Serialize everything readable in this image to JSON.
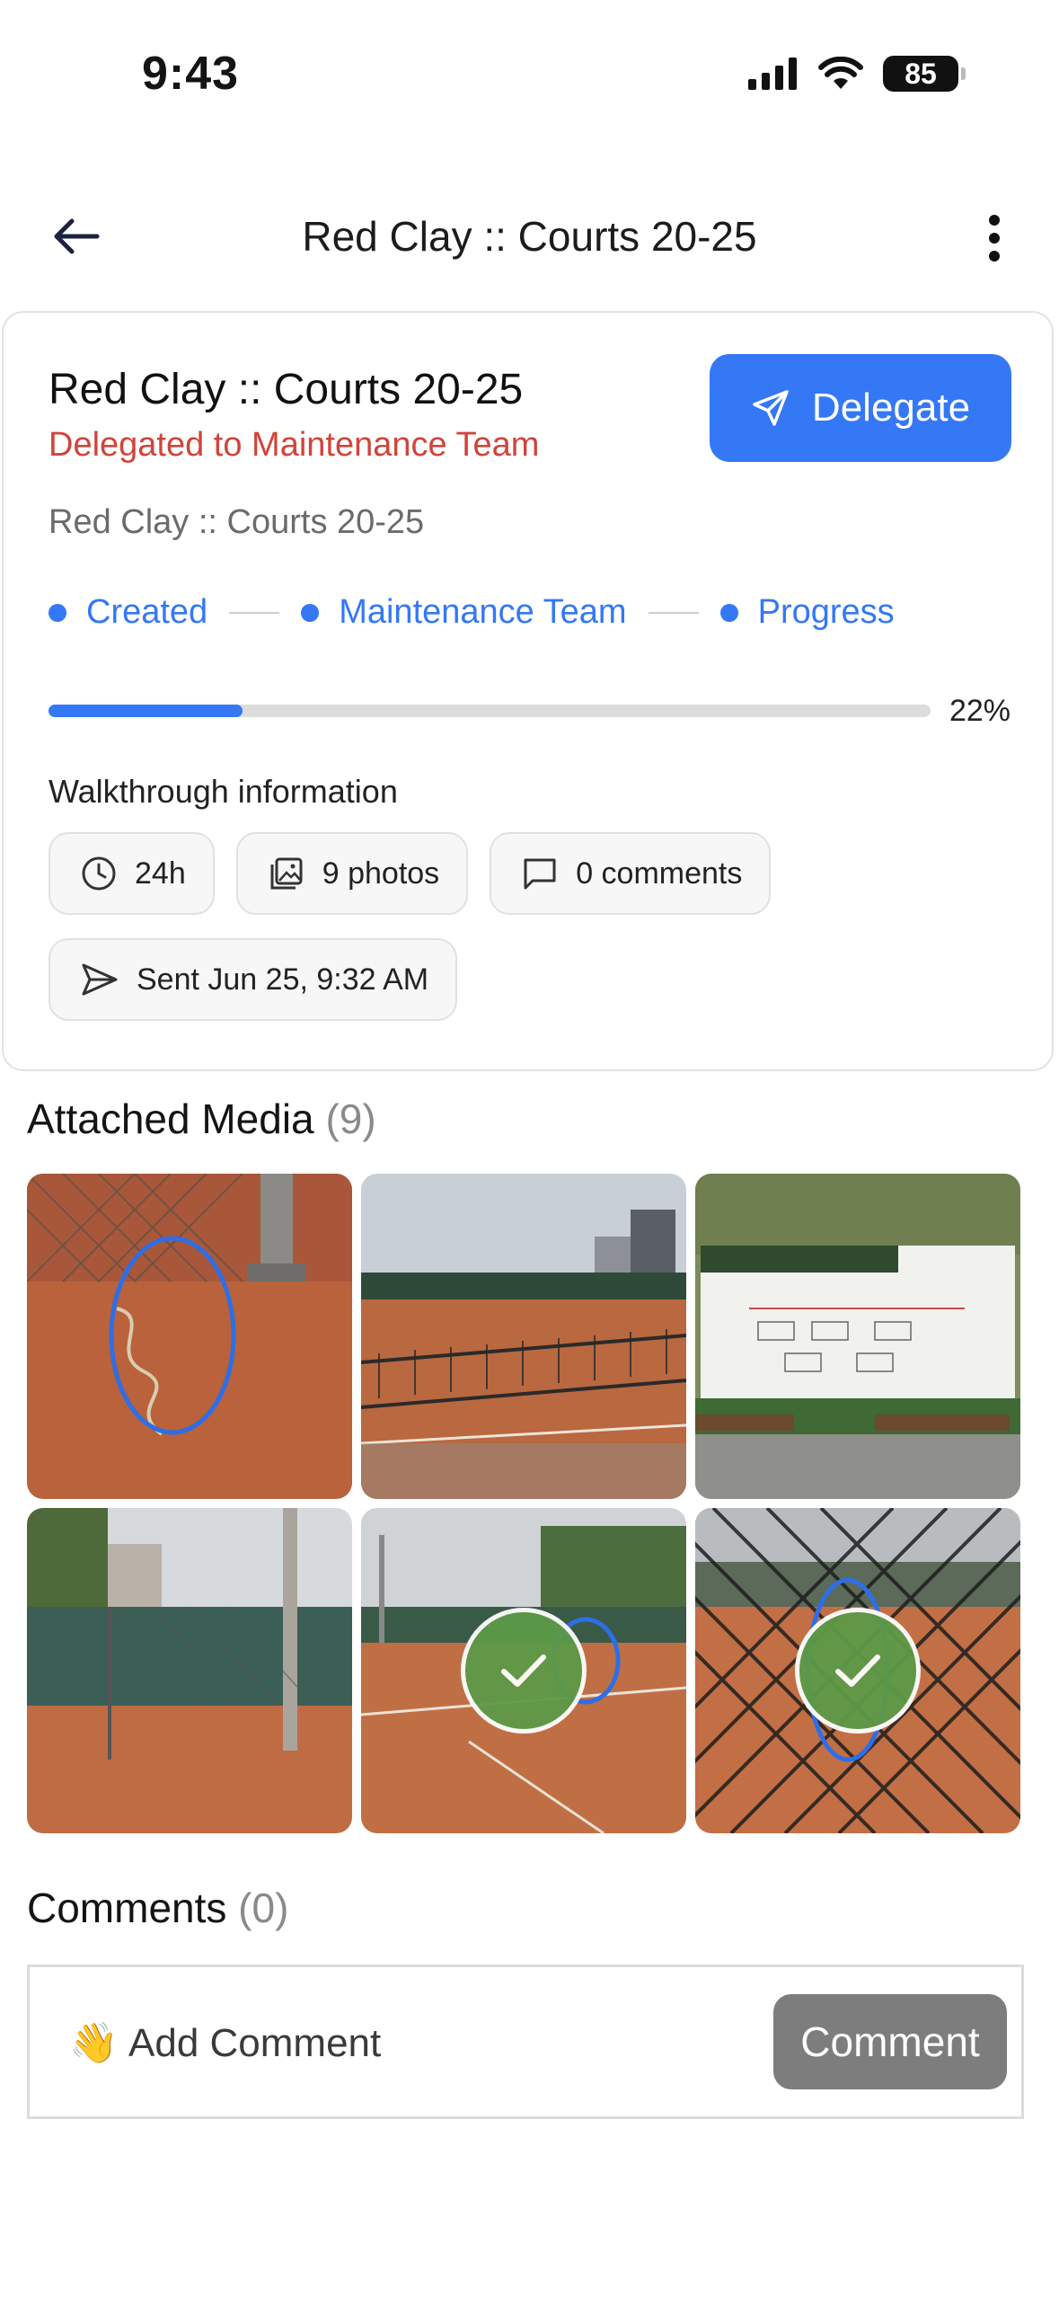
{
  "status_bar": {
    "time": "9:43",
    "battery": "85"
  },
  "header": {
    "title": "Red Clay :: Courts 20-25"
  },
  "card": {
    "title": "Red Clay :: Courts 20-25",
    "subtitle": "Delegated to Maintenance Team",
    "delegate_label": "Delegate",
    "description": "Red Clay :: Courts 20-25",
    "steps": [
      "Created",
      "Maintenance Team",
      "Progress"
    ],
    "progress": {
      "percent": 22,
      "label": "22%"
    },
    "walkthrough_label": "Walkthrough information",
    "chips": {
      "duration": "24h",
      "photos": "9 photos",
      "comments": "0 comments",
      "sent": "Sent Jun 25, 9:32 AM"
    }
  },
  "media": {
    "title": "Attached Media",
    "count": "(9)"
  },
  "comments": {
    "title": "Comments",
    "count": "(0)",
    "emoji": "👋",
    "placeholder": "Add Comment",
    "button_label": "Comment"
  },
  "colors": {
    "accent": "#3478f6",
    "delegated": "#d0443a",
    "check": "#5c9a47"
  }
}
